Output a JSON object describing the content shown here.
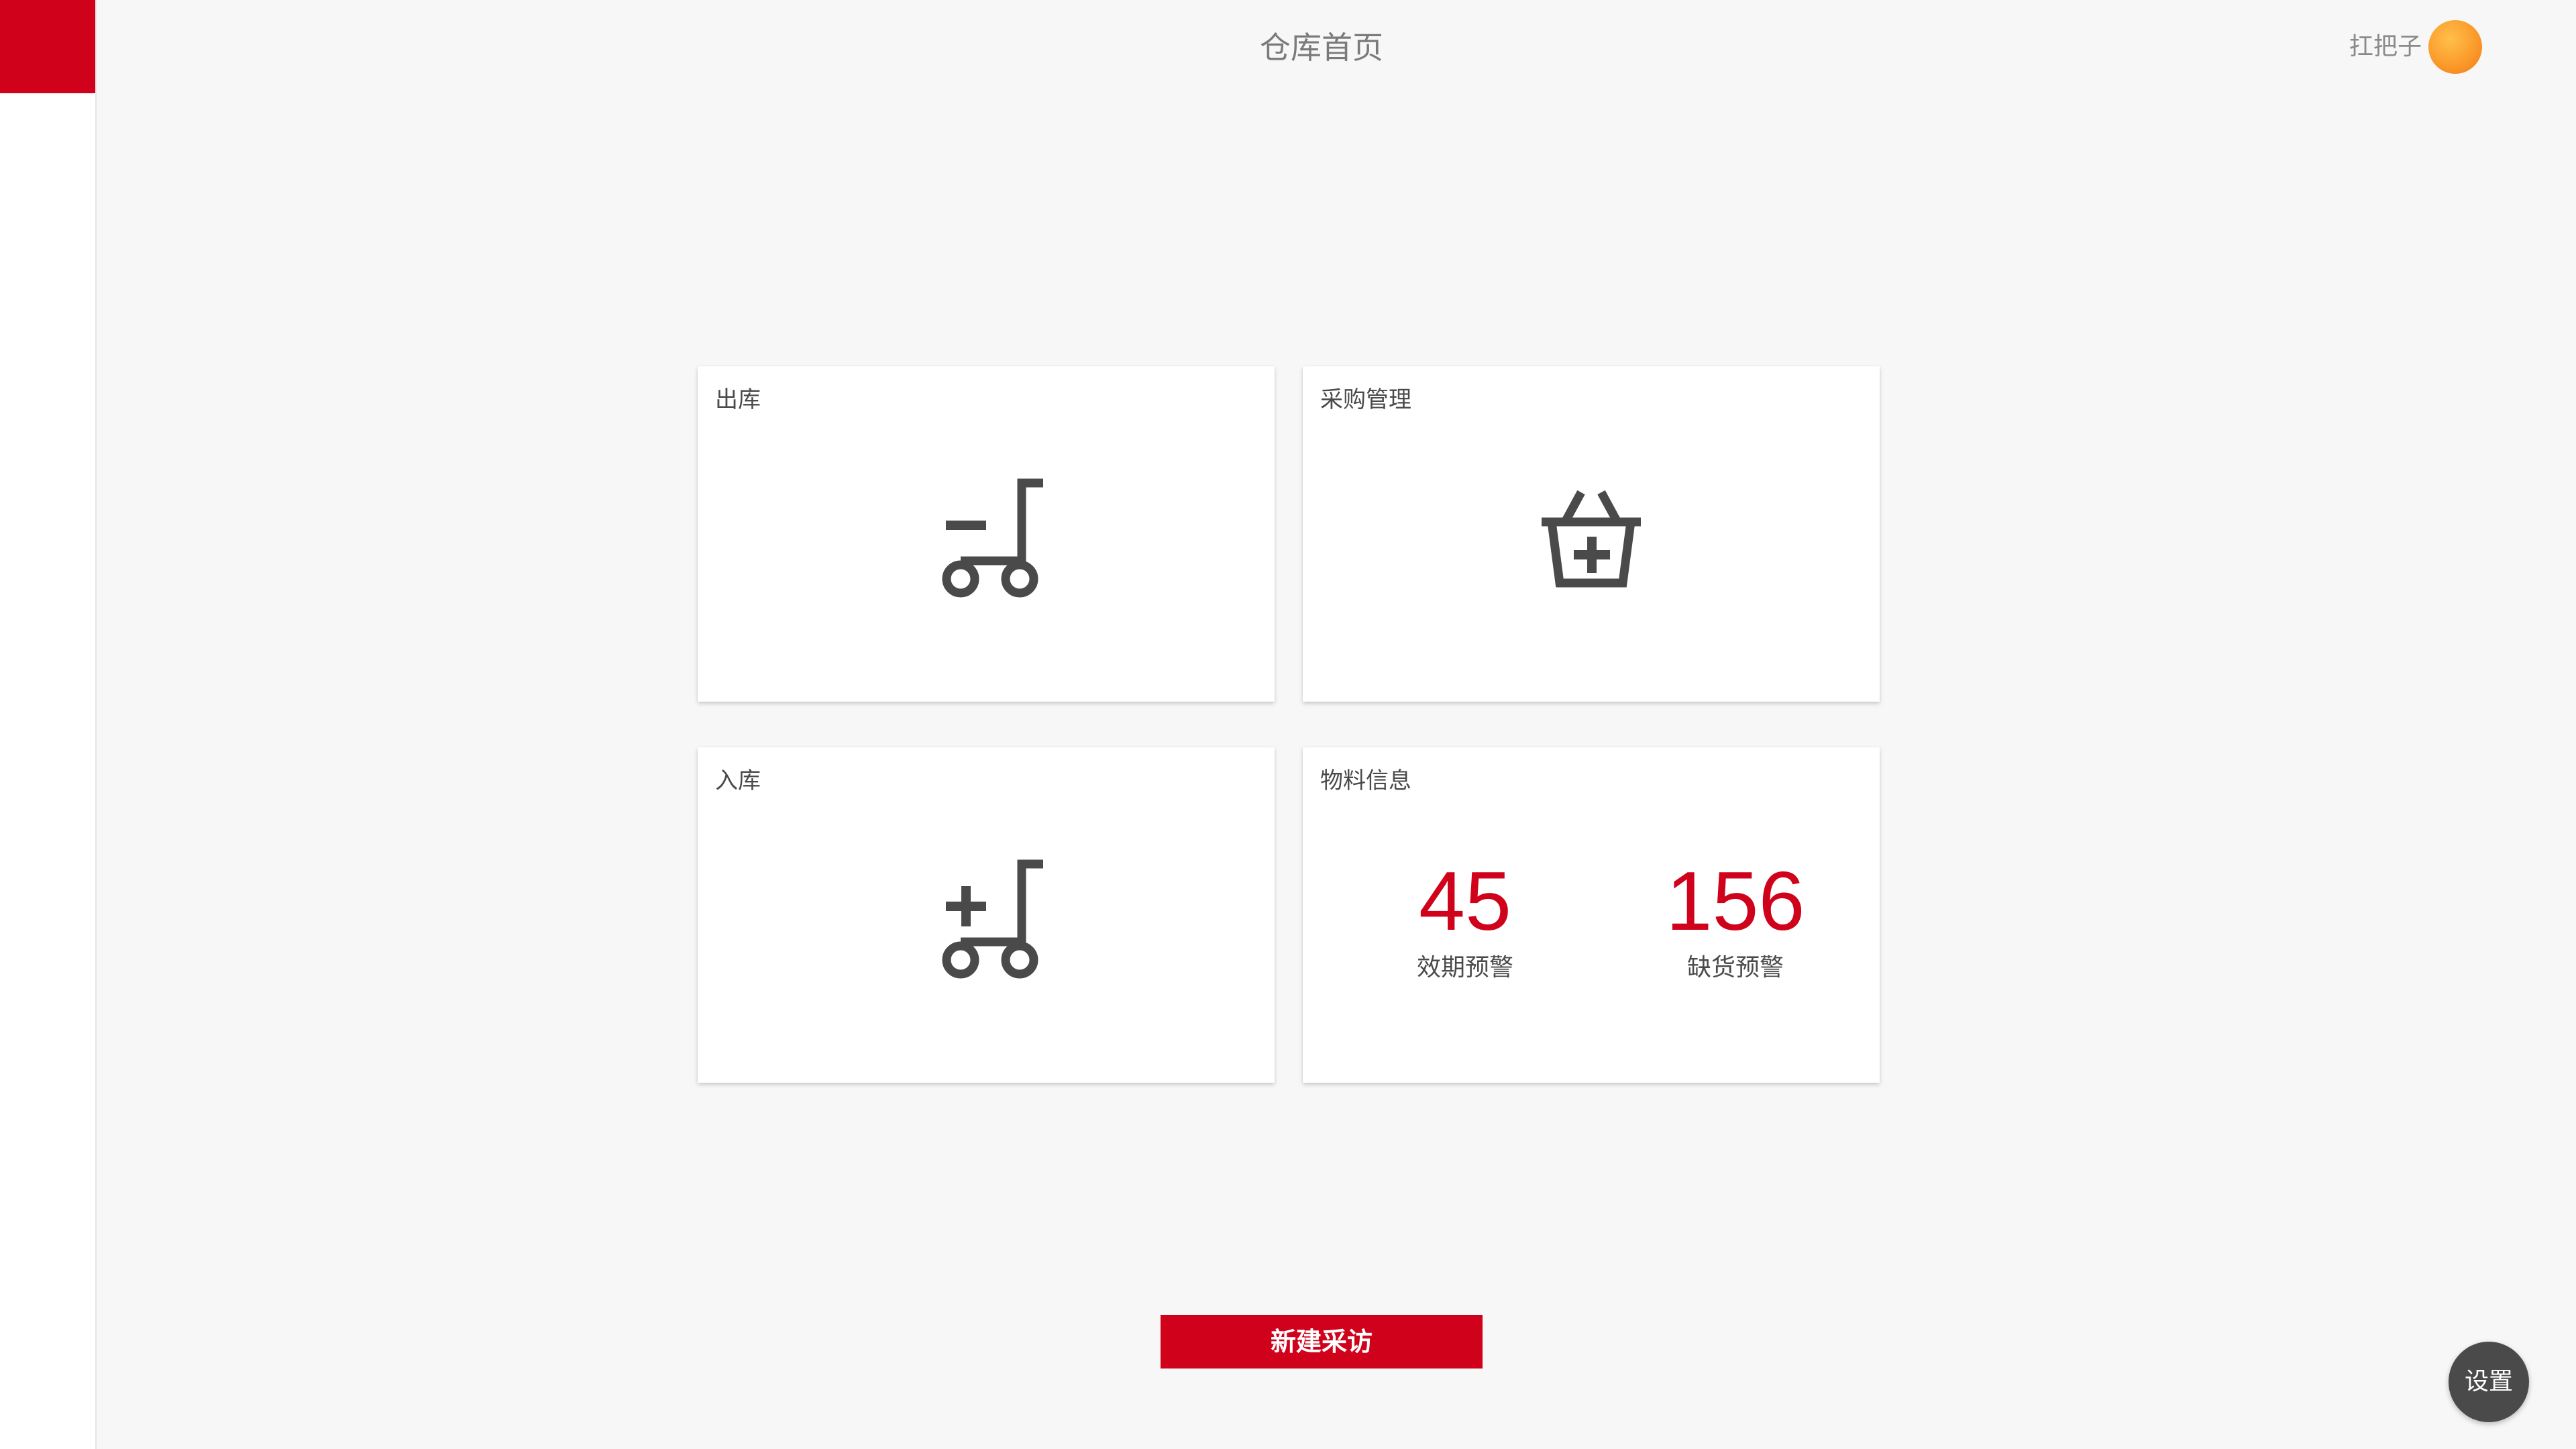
{
  "header": {
    "title": "仓库首页",
    "user_name": "扛把子"
  },
  "cards": {
    "outbound": {
      "title": "出库",
      "icon": "cart-minus-icon"
    },
    "purchase": {
      "title": "采购管理",
      "icon": "basket-plus-icon"
    },
    "inbound": {
      "title": "入库",
      "icon": "cart-plus-icon"
    },
    "materials": {
      "title": "物料信息",
      "stats": [
        {
          "value": "45",
          "label": "效期预警"
        },
        {
          "value": "156",
          "label": "缺货预警"
        }
      ]
    }
  },
  "actions": {
    "new_purchase_label": "新建采访",
    "settings_label": "设置"
  },
  "colors": {
    "accent": "#d0021b",
    "icon": "#4a4a4a",
    "background": "#f7f7f7",
    "avatar": "#fb9b2c"
  }
}
